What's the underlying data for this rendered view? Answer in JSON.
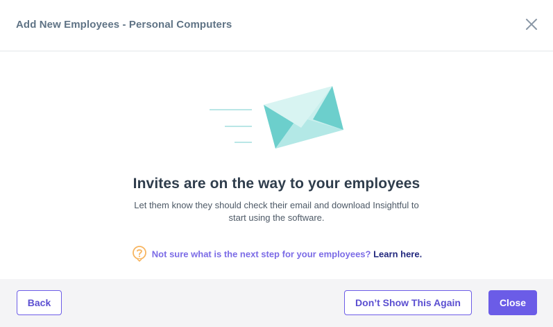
{
  "header": {
    "title": "Add New Employees - Personal Computers",
    "close_icon": "close-icon"
  },
  "main": {
    "illustration_icon": "envelope-icon",
    "headline": "Invites are on the way to your employees",
    "subtext": "Let them know they should check their email and download Insightful to start using the software.",
    "help": {
      "icon": "question-bulb-icon",
      "text": "Not sure what is the next step for your employees?",
      "link_label": "Learn here."
    }
  },
  "footer": {
    "back_label": "Back",
    "dont_show_label": "Don’t Show This Again",
    "close_label": "Close"
  },
  "colors": {
    "accent": "#6b5ce7",
    "envelope_teal": "#6ccfcc",
    "envelope_light": "#c9efed",
    "help_icon": "#f7b560"
  }
}
